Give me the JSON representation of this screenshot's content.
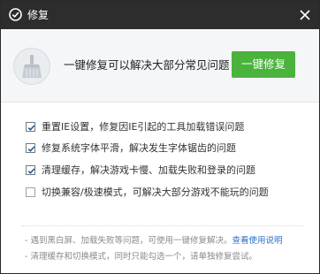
{
  "window": {
    "title": "修复"
  },
  "header": {
    "icon": "broom-icon",
    "headline": "一键修复可以解决大部分常见问题",
    "repair_button": "一键修复"
  },
  "options": [
    {
      "label": "重置IE设置，修复因IE引起的工具加载错误问题",
      "checked": true
    },
    {
      "label": "修复系统字体平滑，解决发生字体锯齿的问题",
      "checked": true
    },
    {
      "label": "清理缓存，解决游戏卡慢、加载失败和登录的问题",
      "checked": true
    },
    {
      "label": "切换兼容/极速模式，可解决大部分游戏不能玩的问题",
      "checked": false
    }
  ],
  "notes": {
    "line1_text": "- 遇到黑白屏、加载失败等问题，可使用一键修复解决。",
    "line1_link": "查看使用说明",
    "line2_text": "- 清理缓存和切换模式，同时只能勾选一个，请单独修复尝试。"
  },
  "colors": {
    "titlebar": "#2d2d2d",
    "accent_green": "#4ab33c",
    "link_blue": "#2b6fc6"
  }
}
